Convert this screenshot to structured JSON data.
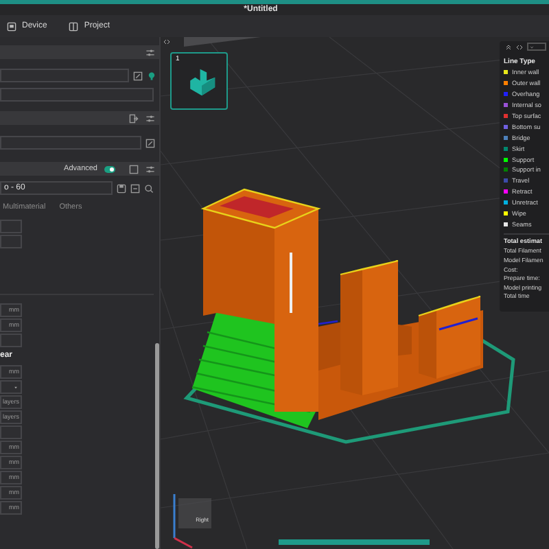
{
  "window": {
    "title": "*Untitled"
  },
  "tabs": [
    {
      "label": "Device",
      "selected": false
    },
    {
      "label": "Project",
      "selected": false
    }
  ],
  "process": {
    "advanced_label": "Advanced",
    "advanced_on": true,
    "preset": "o - 60",
    "tabs": [
      {
        "label": "Multimaterial",
        "selected": false
      },
      {
        "label": "Others",
        "selected": false
      }
    ]
  },
  "settings_top": [
    {
      "kind": "field"
    },
    {
      "kind": "field"
    }
  ],
  "settings": [
    {
      "kind": "field",
      "unit": "mm"
    },
    {
      "kind": "field",
      "unit": "mm"
    },
    {
      "kind": "field"
    },
    {
      "kind": "heading",
      "label": "ear"
    },
    {
      "kind": "field",
      "unit": "mm"
    },
    {
      "kind": "dropdown"
    },
    {
      "kind": "field",
      "unit": "layers"
    },
    {
      "kind": "field",
      "unit": "layers"
    },
    {
      "kind": "field"
    },
    {
      "kind": "field",
      "unit": "mm"
    },
    {
      "kind": "field",
      "unit": "mm"
    },
    {
      "kind": "field",
      "unit": "mm"
    },
    {
      "kind": "field",
      "unit": "mm"
    },
    {
      "kind": "field",
      "unit": "mm"
    }
  ],
  "plate_thumbnail": {
    "label": "1",
    "selected": true
  },
  "legend": {
    "title": "Line Type",
    "items": [
      {
        "label": "Inner wall",
        "color": "#e8e81a"
      },
      {
        "label": "Outer wall",
        "color": "#ff7f00"
      },
      {
        "label": "Overhang",
        "color": "#2020ff"
      },
      {
        "label": "Internal so",
        "color": "#9a52d6"
      },
      {
        "label": "Top surfac",
        "color": "#e03030"
      },
      {
        "label": "Bottom su",
        "color": "#7060e0"
      },
      {
        "label": "Bridge",
        "color": "#4d80ba"
      },
      {
        "label": "Skirt",
        "color": "#00876e"
      },
      {
        "label": "Support",
        "color": "#00ff00"
      },
      {
        "label": "Support in",
        "color": "#008000"
      },
      {
        "label": "Travel",
        "color": "#3c4ca8"
      },
      {
        "label": "Retract",
        "color": "#ff00ff"
      },
      {
        "label": "Unretract",
        "color": "#00b0e0"
      },
      {
        "label": "Wipe",
        "color": "#ffff00"
      },
      {
        "label": "Seams",
        "color": "#e6e6e6"
      }
    ],
    "summary_title": "Total estimat",
    "summary": [
      "Total Filament",
      "Model Filamen",
      "Cost:",
      "Prepare time:",
      "Model printing",
      "Total time"
    ]
  },
  "axis_cube": {
    "label": "Right"
  }
}
